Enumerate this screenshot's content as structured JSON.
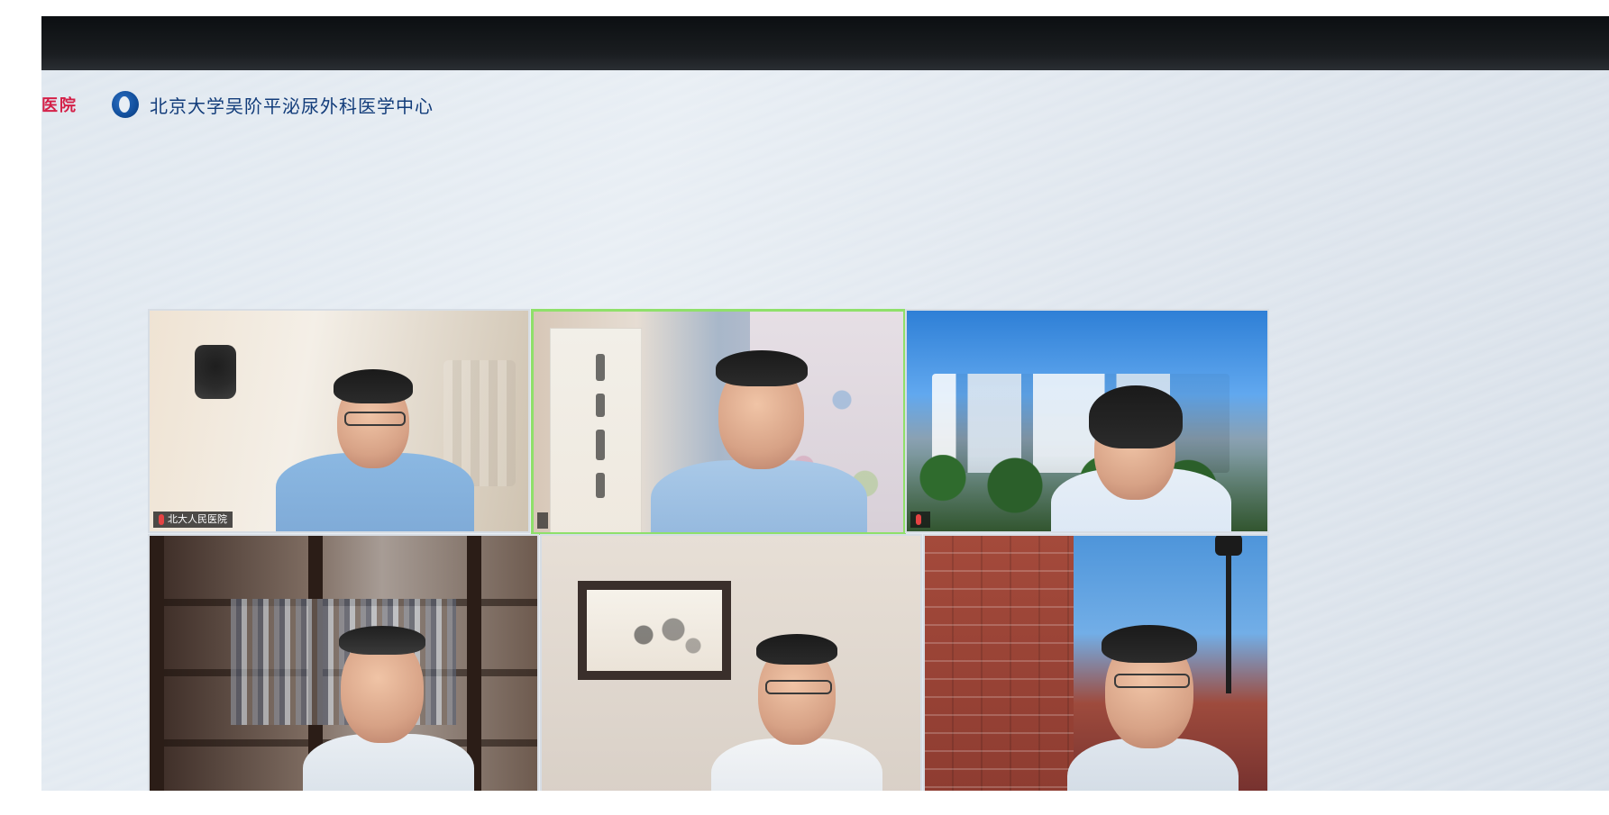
{
  "header": {
    "hospital_short": "医院",
    "university_line": "北京大学吴阶平泌尿外科医学中心"
  },
  "meeting": {
    "tiles": [
      {
        "tag": "北大人民医院",
        "speaking": false
      },
      {
        "tag": "",
        "speaking": true
      },
      {
        "tag": "",
        "speaking": false
      },
      {
        "tag": "",
        "speaking": false
      },
      {
        "tag": "",
        "speaking": false
      },
      {
        "tag": "",
        "speaking": false
      }
    ]
  },
  "colors": {
    "brand_red": "#d41f47",
    "brand_blue": "#123c7a",
    "active_border": "#8fe06a"
  },
  "icons": {
    "university_logo": "university-logo-icon",
    "mic": "mic-icon"
  }
}
